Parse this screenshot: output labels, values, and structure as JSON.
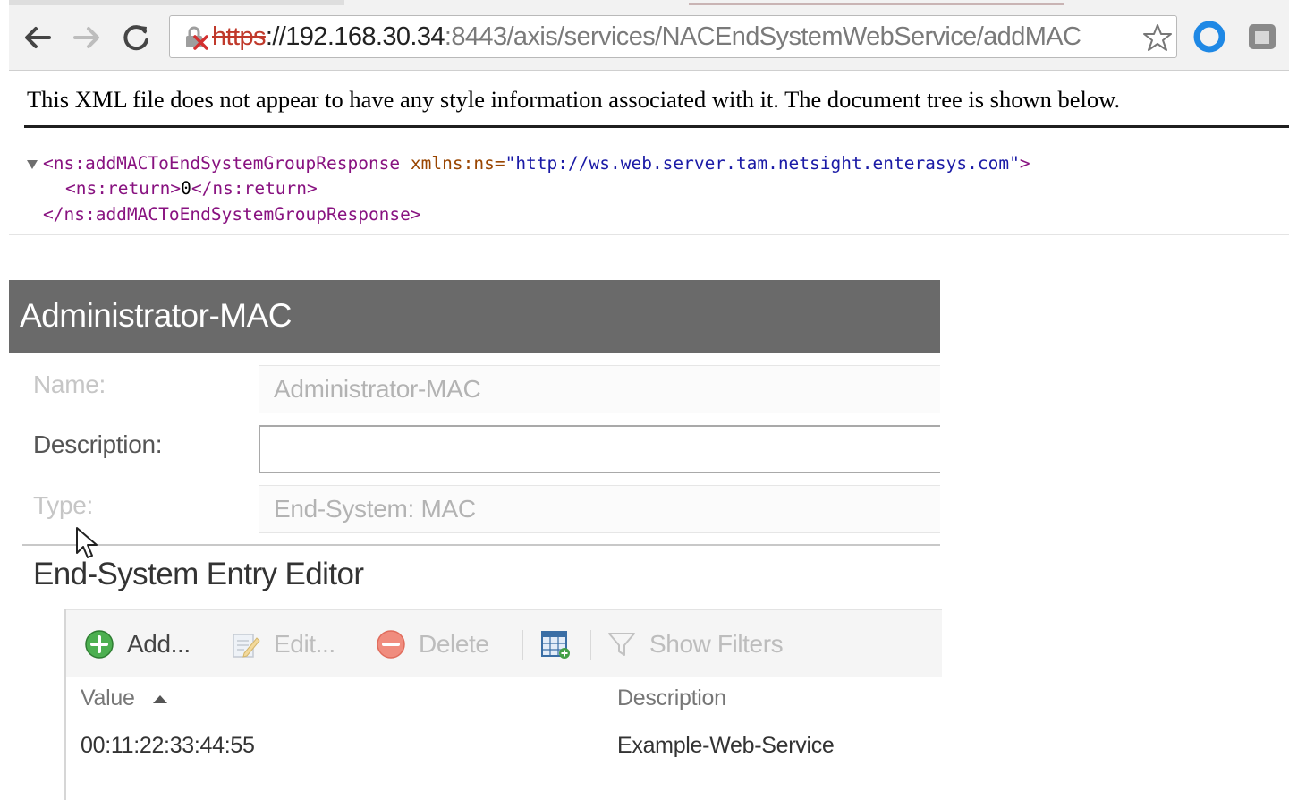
{
  "browser": {
    "url": {
      "scheme": "https",
      "host": "://192.168.30.34",
      "rest": ":8443/axis/services/NACEndSystemWebService/addMAC"
    },
    "icons": {
      "back": "back-arrow-icon",
      "forward": "forward-arrow-icon",
      "reload": "reload-icon",
      "security": "insecure-lock-icon",
      "bookmark": "star-icon",
      "extension1": "ring-extension-icon",
      "extension2": "gray-extension-icon"
    }
  },
  "xml_viewer": {
    "notice": "This XML file does not appear to have any style information associated with it. The document tree is shown below.",
    "root_open_tag": "<ns:addMACToEndSystemGroupResponse",
    "root_attr_name": " xmlns:ns=",
    "root_attr_value": "\"http://ws.web.server.tam.netsight.enterasys.com\"",
    "root_open_close": ">",
    "child_open": "<ns:return>",
    "child_text": "0",
    "child_close": "</ns:return>",
    "root_close_tag": "</ns:addMACToEndSystemGroupResponse>"
  },
  "panel": {
    "title": "Administrator-MAC",
    "name_label": "Name:",
    "name_value": "Administrator-MAC",
    "description_label": "Description:",
    "description_value": "",
    "type_label": "Type:",
    "type_value": "End-System: MAC",
    "section_title": "End-System Entry Editor",
    "toolbar": {
      "add": "Add...",
      "edit": "Edit...",
      "delete": "Delete",
      "show_filters": "Show Filters",
      "icons": [
        "add-circle-icon",
        "edit-icon",
        "delete-circle-icon",
        "table-export-icon",
        "filter-icon"
      ]
    },
    "table": {
      "columns": [
        "Value",
        "Description"
      ],
      "sort_column": "Value",
      "sort_direction": "ascending",
      "rows": [
        {
          "value": "00:11:22:33:44:55",
          "description": "Example-Web-Service"
        }
      ]
    }
  },
  "colors": {
    "panel_header": "#6a6a6a",
    "xml_tag": "#881280",
    "xml_attr": "#994500",
    "xml_value": "#1a1aa6",
    "insecure_scheme": "#c0392b",
    "extension_blue": "#1e88e5"
  }
}
